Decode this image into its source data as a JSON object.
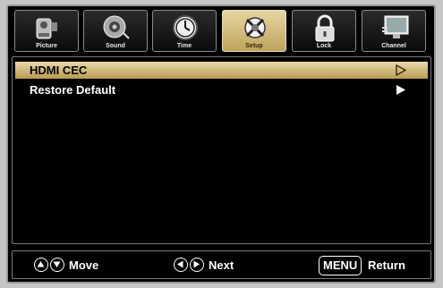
{
  "tabs": [
    {
      "label": "Picture",
      "icon": "camcorder-icon"
    },
    {
      "label": "Sound",
      "icon": "speaker-icon"
    },
    {
      "label": "Time",
      "icon": "clock-icon"
    },
    {
      "label": "Setup",
      "icon": "settings-tools-icon",
      "active": true
    },
    {
      "label": "Lock",
      "icon": "padlock-icon"
    },
    {
      "label": "Channel",
      "icon": "tv-screen-icon"
    }
  ],
  "menu": {
    "items": [
      {
        "label": "HDMI CEC",
        "selected": true
      },
      {
        "label": "Restore Default",
        "selected": false
      }
    ]
  },
  "footer": {
    "move_label": "Move",
    "next_label": "Next",
    "menu_key": "MENU",
    "return_label": "Return"
  },
  "colors": {
    "highlight": "#d8c383",
    "background": "#000000",
    "frame": "#c6c6c6"
  }
}
